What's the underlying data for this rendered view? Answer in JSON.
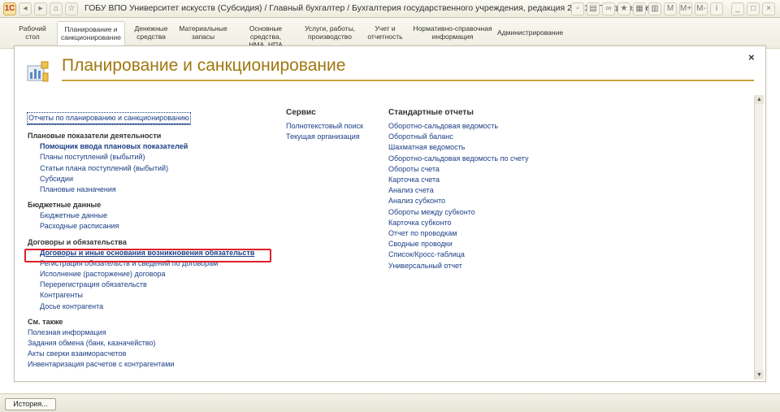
{
  "window": {
    "title": "ГОБУ ВПО Университет искусств (Субсидия) / Главный бухгалтер / Бухгалтерия государственного учреждения, редакция 2.0  (1С:Предприятие)"
  },
  "sections": [
    {
      "line1": "Рабочий",
      "line2": "стол"
    },
    {
      "line1": "Планирование и",
      "line2": "санкционирование"
    },
    {
      "line1": "Денежные",
      "line2": "средства"
    },
    {
      "line1": "Материальные",
      "line2": "запасы"
    },
    {
      "line1": "Основные средства,",
      "line2": "НМА, НПА"
    },
    {
      "line1": "Услуги, работы,",
      "line2": "производство"
    },
    {
      "line1": "Учет и",
      "line2": "отчетность"
    },
    {
      "line1": "Нормативно-справочная",
      "line2": "информация"
    },
    {
      "line1": "Администрирование",
      "line2": ""
    }
  ],
  "main": {
    "title": "Планирование и санкционирование",
    "close": "×"
  },
  "col1": {
    "top_link": "Отчеты по планированию и санкционированию",
    "groups": [
      {
        "heading": "Плановые показатели деятельности",
        "items": [
          "Помощник ввода плановых показателей",
          "Планы поступлений (выбытий)",
          "Статьи плана поступлений (выбытий)",
          "Субсидии",
          "Плановые назначения"
        ]
      },
      {
        "heading": "Бюджетные данные",
        "items": [
          "Бюджетные данные",
          "Расходные расписания"
        ]
      },
      {
        "heading": "Договоры и обязательства",
        "items": [
          "Договоры и иные основания возникновения обязательств",
          "Регистрация обязательств и сведений по договорам",
          "Исполнение (расторжение) договора",
          "Перерегистрация обязательств",
          "Контрагенты",
          "Досье контрагента"
        ]
      }
    ],
    "see_also": {
      "heading": "См. также",
      "items": [
        "Полезная информация",
        "Задания обмена (банк, казначейство)",
        "Акты сверки взаиморасчетов",
        "Инвентаризация расчетов с контрагентами"
      ]
    }
  },
  "col2": {
    "heading": "Сервис",
    "items": [
      "Полнотекстовый поиск",
      "Текущая организация"
    ]
  },
  "col3": {
    "heading": "Стандартные отчеты",
    "items": [
      "Оборотно-сальдовая ведомость",
      "Оборотный баланс",
      "Шахматная ведомость",
      "Оборотно-сальдовая ведомость по счету",
      "Обороты счета",
      "Карточка счета",
      "Анализ счета",
      "Анализ субконто",
      "Обороты между субконто",
      "Карточка субконто",
      "Отчет по проводкам",
      "Сводные проводки",
      "Список/Кросс-таблица",
      "Универсальный отчет"
    ]
  },
  "bottom": {
    "history": "История..."
  },
  "colors": {
    "accent": "#a07810",
    "link": "#1c3f86",
    "highlight": "#e0202a"
  }
}
